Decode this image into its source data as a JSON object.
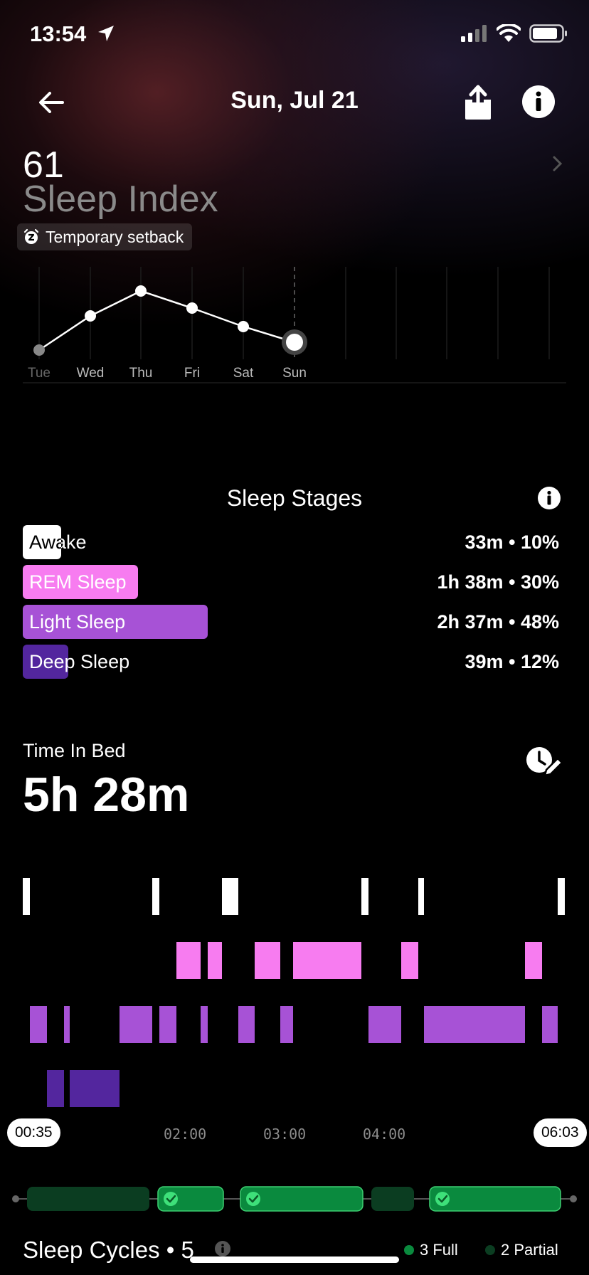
{
  "status_bar": {
    "time": "13:54"
  },
  "header": {
    "title": "Sun, Jul 21"
  },
  "score": {
    "value": "61",
    "label": "Sleep Index",
    "badge": "Temporary setback"
  },
  "trend": {
    "days": [
      "Tue",
      "Wed",
      "Thu",
      "Fri",
      "Sat",
      "Sun"
    ],
    "selected_day": "Sun"
  },
  "sleep_stages": {
    "title": "Sleep Stages",
    "stages": [
      {
        "name": "Awake",
        "value": "33m • 10%",
        "percent": 10,
        "color": "#ffffff"
      },
      {
        "name": "REM Sleep",
        "value": "1h 38m • 30%",
        "percent": 30,
        "color": "#f77cf0"
      },
      {
        "name": "Light Sleep",
        "value": "2h 37m • 48%",
        "percent": 48,
        "color": "#a752d6"
      },
      {
        "name": "Deep Sleep",
        "value": "39m • 12%",
        "percent": 12,
        "color": "#53269e"
      }
    ]
  },
  "time_in_bed": {
    "label": "Time In Bed",
    "value": "5h 28m",
    "start": "00:35",
    "end": "06:03",
    "ticks": [
      "02:00",
      "03:00",
      "04:00"
    ]
  },
  "sleep_cycles": {
    "title": "Sleep Cycles • 5",
    "full_label": "3 Full",
    "partial_label": "2 Partial",
    "full_color": "#0a8a3e",
    "partial_color": "#0b3d21"
  }
}
